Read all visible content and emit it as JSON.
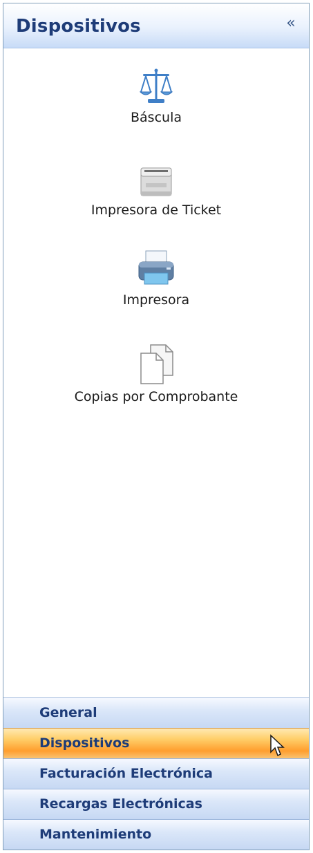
{
  "panel": {
    "title": "Dispositivos",
    "collapse_glyph": "«",
    "items": [
      {
        "label": "Báscula",
        "icon": "scale-icon"
      },
      {
        "label": "Impresora de Ticket",
        "icon": "ticket-printer-icon"
      },
      {
        "label": "Impresora",
        "icon": "printer-icon"
      },
      {
        "label": "Copias por Comprobante",
        "icon": "copies-icon"
      }
    ]
  },
  "nav": {
    "items": [
      {
        "label": "General",
        "active": false
      },
      {
        "label": "Dispositivos",
        "active": true
      },
      {
        "label": "Facturación Electrónica",
        "active": false
      },
      {
        "label": "Recargas Electrónicas",
        "active": false
      },
      {
        "label": "Mantenimiento",
        "active": false
      }
    ]
  },
  "colors": {
    "header_text": "#1e3c78",
    "active_orange": "#ff9e2e",
    "nav_blue": "#c6d8f3"
  }
}
